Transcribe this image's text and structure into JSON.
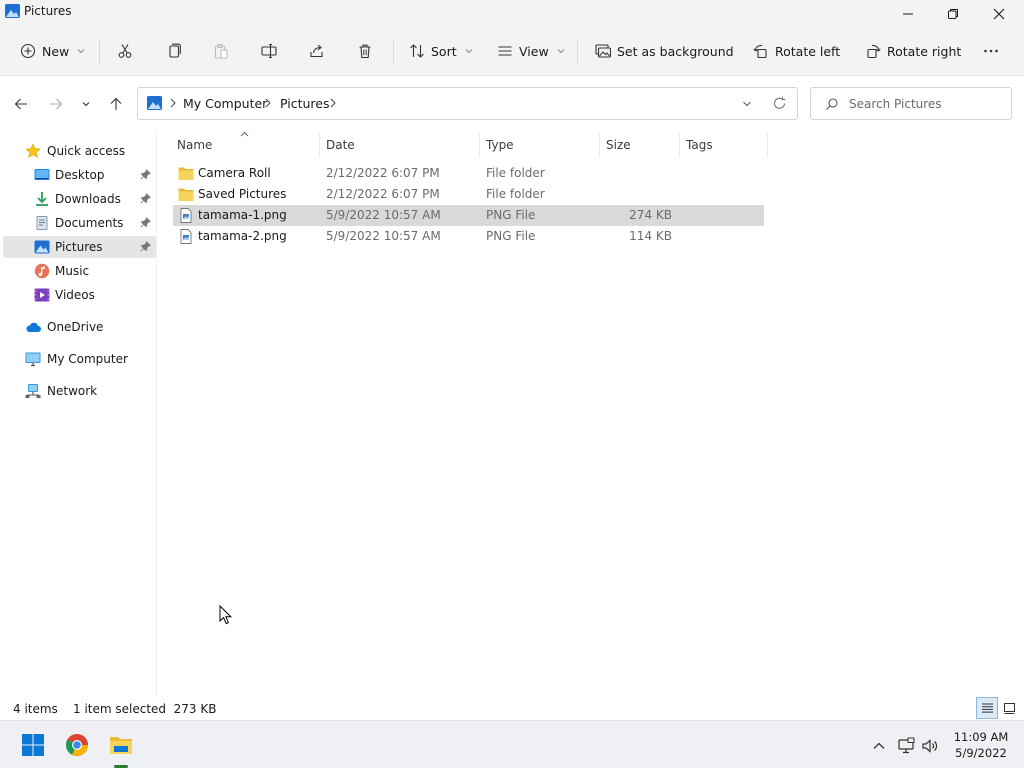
{
  "window": {
    "title": "Pictures"
  },
  "toolbar": {
    "new_label": "New",
    "sort_label": "Sort",
    "view_label": "View",
    "set_background_label": "Set as background",
    "rotate_left_label": "Rotate left",
    "rotate_right_label": "Rotate right"
  },
  "address": {
    "crumbs": [
      "My Computer",
      "Pictures"
    ],
    "search_placeholder": "Search Pictures"
  },
  "sidebar": {
    "items": [
      {
        "label": "Quick access",
        "icon": "star-icon"
      },
      {
        "label": "Desktop",
        "icon": "desktop-icon",
        "pinned": true
      },
      {
        "label": "Downloads",
        "icon": "download-icon",
        "pinned": true
      },
      {
        "label": "Documents",
        "icon": "documents-icon",
        "pinned": true
      },
      {
        "label": "Pictures",
        "icon": "pictures-icon",
        "pinned": true,
        "selected": true
      },
      {
        "label": "Music",
        "icon": "music-icon"
      },
      {
        "label": "Videos",
        "icon": "videos-icon"
      },
      {
        "label": "OneDrive",
        "icon": "cloud-icon"
      },
      {
        "label": "My Computer",
        "icon": "monitor-icon"
      },
      {
        "label": "Network",
        "icon": "network-icon"
      }
    ]
  },
  "filelist": {
    "columns": [
      "Name",
      "Date",
      "Type",
      "Size",
      "Tags"
    ],
    "rows": [
      {
        "name": "Camera Roll",
        "date": "2/12/2022 6:07 PM",
        "type": "File folder",
        "size": "",
        "icon": "folder-icon"
      },
      {
        "name": "Saved Pictures",
        "date": "2/12/2022 6:07 PM",
        "type": "File folder",
        "size": "",
        "icon": "folder-icon"
      },
      {
        "name": "tamama-1.png",
        "date": "5/9/2022 10:57 AM",
        "type": "PNG File",
        "size": "274 KB",
        "icon": "image-file-icon",
        "selected": true
      },
      {
        "name": "tamama-2.png",
        "date": "5/9/2022 10:57 AM",
        "type": "PNG File",
        "size": "114 KB",
        "icon": "image-file-icon"
      }
    ]
  },
  "status": {
    "item_count": "4 items",
    "selection": "1 item selected  273 KB"
  },
  "clock": {
    "time": "11:09 AM",
    "date": "5/9/2022"
  },
  "colors": {
    "accent": "#0067c0",
    "selected_row": "#d9d9d9",
    "folder": "#f4c430"
  }
}
